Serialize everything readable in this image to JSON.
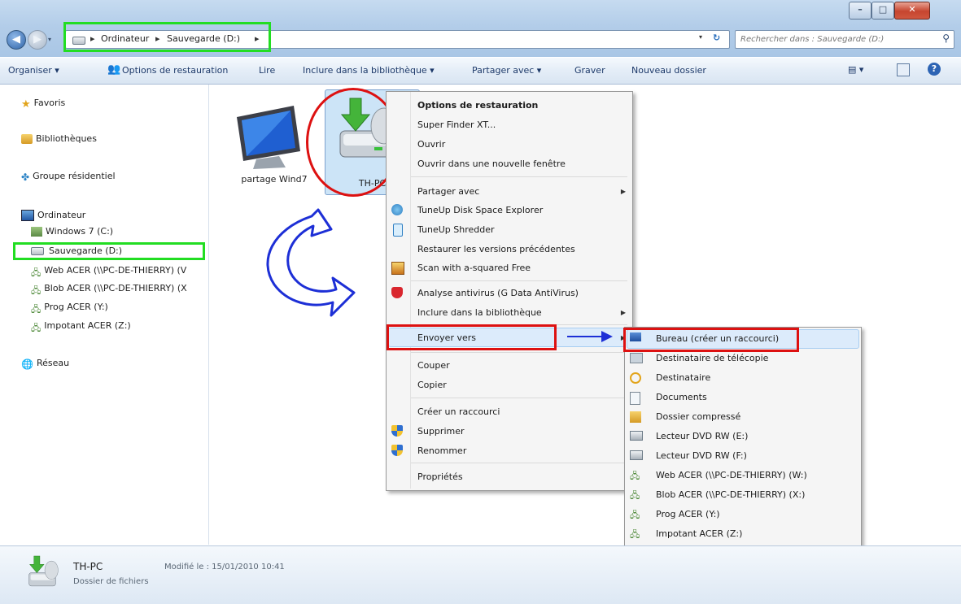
{
  "window": {
    "controls": [
      "–",
      "□",
      "✕"
    ]
  },
  "address": {
    "crumbs": [
      "Ordinateur",
      "Sauvegarde (D:)"
    ],
    "search_placeholder": "Rechercher dans : Sauvegarde (D:)"
  },
  "toolbar": {
    "organize": "Organiser ▾",
    "restore_options": "Options de restauration",
    "read": "Lire",
    "include_library": "Inclure dans la bibliothèque ▾",
    "share_with": "Partager avec ▾",
    "burn": "Graver",
    "new_folder": "Nouveau dossier"
  },
  "sidebar": {
    "favorites": "Favoris",
    "libraries": "Bibliothèques",
    "homegroup": "Groupe résidentiel",
    "computer": "Ordinateur",
    "drives": [
      "Windows 7 (C:)",
      "Sauvegarde (D:)",
      "Web ACER (\\\\PC-DE-THIERRY) (V",
      "Blob ACER (\\\\PC-DE-THIERRY) (X",
      "Prog ACER (Y:)",
      "Impotant ACER (Z:)"
    ],
    "network": "Réseau"
  },
  "files": [
    {
      "name": "partage Wind7"
    },
    {
      "name": "TH-PC"
    }
  ],
  "context_menu": {
    "restore_options": "Options de restauration",
    "super_finder": "Super Finder XT...",
    "open": "Ouvrir",
    "open_new_window": "Ouvrir dans une nouvelle fenêtre",
    "share_with": "Partager avec",
    "tuneup_disk": "TuneUp Disk Space Explorer",
    "tuneup_shredder": "TuneUp Shredder",
    "restore_versions": "Restaurer les versions précédentes",
    "scan_asquared": "Scan with a-squared Free",
    "antivirus": "Analyse antivirus (G Data AntiVirus)",
    "include_library": "Inclure dans la bibliothèque",
    "send_to": "Envoyer vers",
    "cut": "Couper",
    "copy": "Copier",
    "create_shortcut": "Créer un raccourci",
    "delete": "Supprimer",
    "rename": "Renommer",
    "properties": "Propriétés"
  },
  "send_to_menu": [
    "Bureau (créer un raccourci)",
    "Destinataire de télécopie",
    "Destinataire",
    "Documents",
    "Dossier compressé",
    "Lecteur DVD RW (E:)",
    "Lecteur DVD RW (F:)",
    "Web ACER (\\\\PC-DE-THIERRY) (W:)",
    "Blob ACER (\\\\PC-DE-THIERRY) (X:)",
    "Prog ACER (Y:)",
    "Impotant ACER (Z:)"
  ],
  "details": {
    "name": "TH-PC",
    "type": "Dossier de fichiers",
    "modified": "Modifié le : 15/01/2010 10:41"
  },
  "colors": {
    "highlight_green": "#22dd22",
    "highlight_red": "#dd1111",
    "arrow_blue": "#1d2fd6",
    "menu_hover": "#dcebfb"
  }
}
